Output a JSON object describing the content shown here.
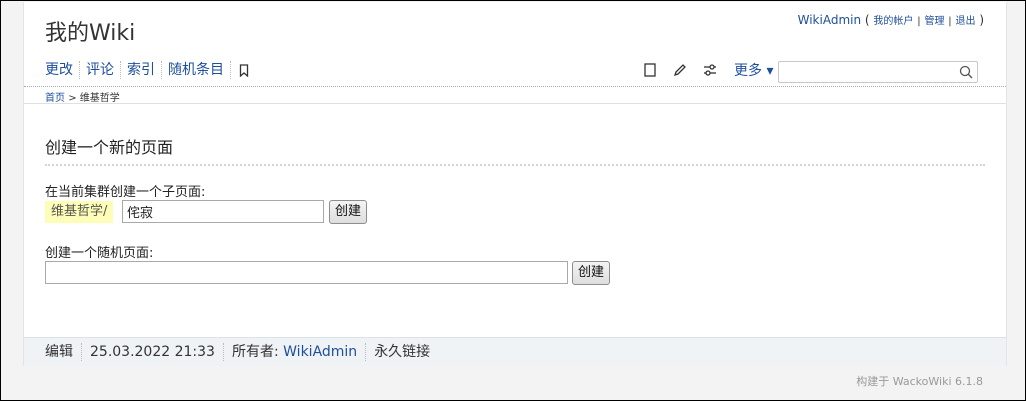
{
  "header": {
    "site_title": "我的Wiki",
    "user": {
      "username": "WikiAdmin",
      "open_paren": "(",
      "my_account": "我的帐户",
      "sep1": "|",
      "admin": "管理",
      "sep2": "|",
      "logout": "退出",
      "close_paren": ")"
    }
  },
  "nav": {
    "items": [
      "更改",
      "评论",
      "索引",
      "随机条目"
    ]
  },
  "tools": {
    "more_label": "更多 ▾"
  },
  "search": {
    "value": "",
    "placeholder": ""
  },
  "breadcrumb": {
    "home": "首页",
    "separator": ">",
    "current": "维基哲学"
  },
  "main": {
    "title": "创建一个新的页面",
    "subpage": {
      "label": "在当前集群创建一个子页面:",
      "cluster": "维基哲学/",
      "value": "侘寂",
      "button": "创建"
    },
    "random": {
      "label": "创建一个随机页面:",
      "value": "",
      "button": "创建"
    }
  },
  "footer": {
    "edit": "编辑",
    "timestamp": "25.03.2022 21:33",
    "owner_label": "所有者:",
    "owner": "WikiAdmin",
    "permalink": "永久链接"
  },
  "powered_by": "构建于 WackoWiki 6.1.8",
  "colors": {
    "link": "#1e4f9c",
    "cluster_highlight": "#fdfdb7",
    "footer_bg": "#f0f3f6"
  }
}
